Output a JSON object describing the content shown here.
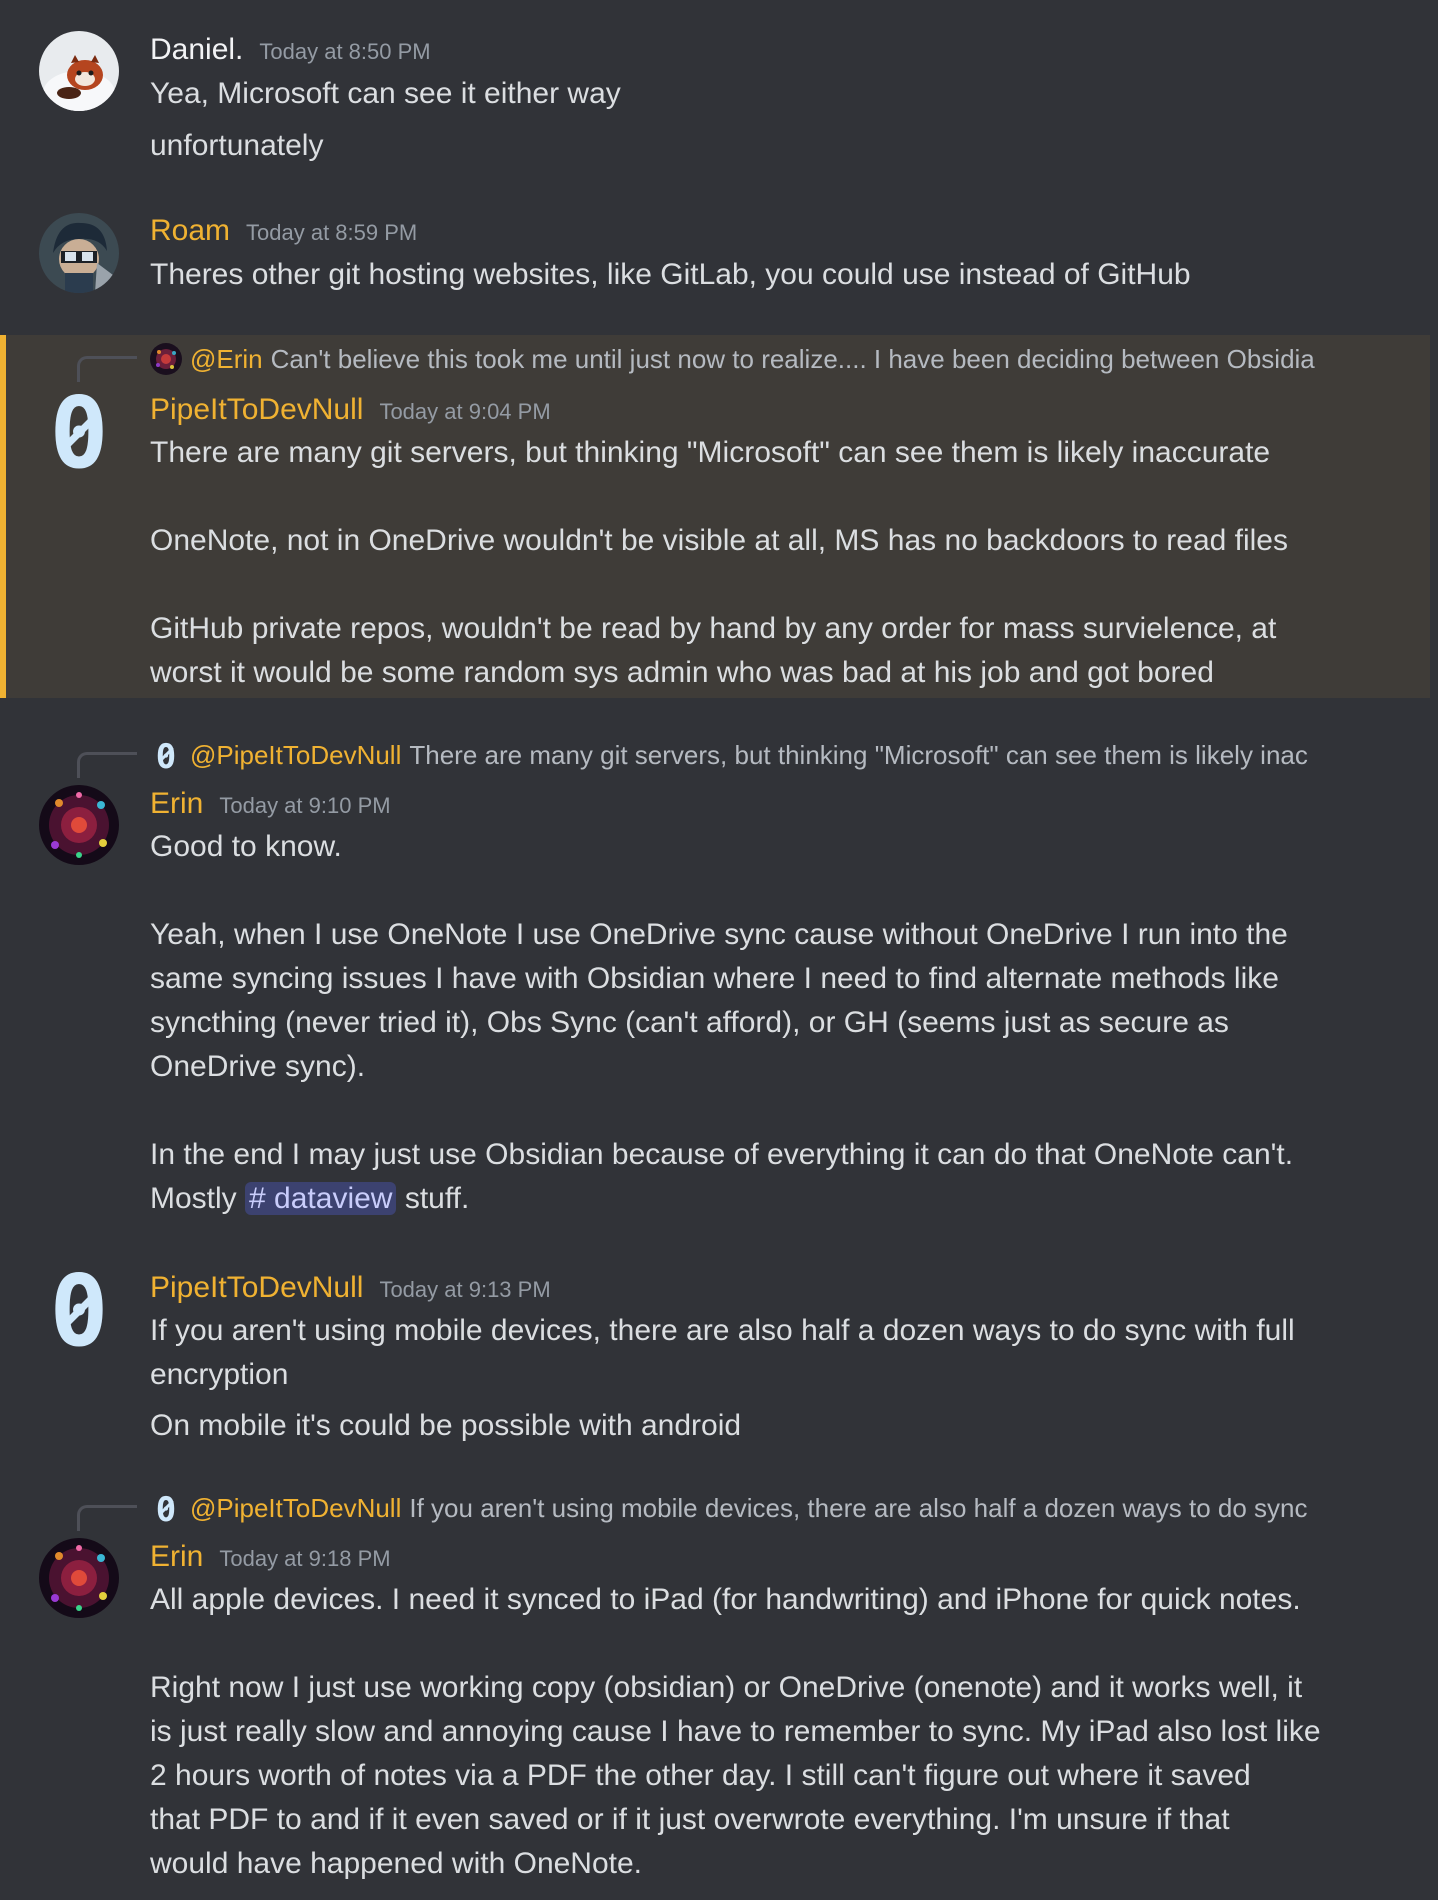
{
  "theme": {
    "background": "#313338",
    "text": "#dbdee1",
    "timestamp": "#949ba4",
    "highlight_bg": "#3f3c38",
    "highlight_bar": "#f0b232",
    "mention_bg": "#3c4270",
    "mention_text": "#c9cdfb"
  },
  "users": {
    "daniel": {
      "name": "Daniel.",
      "color": "#f2f3f5",
      "avatar_icon": "red-panda-avatar"
    },
    "roam": {
      "name": "Roam",
      "color": "#f0b232",
      "avatar_icon": "masked-character-avatar"
    },
    "pipe": {
      "name": "PipeItToDevNull",
      "color": "#f0b232",
      "avatar_icon": "zero-glyph-avatar"
    },
    "erin": {
      "name": "Erin",
      "color": "#f0b232",
      "avatar_icon": "fireworks-avatar"
    }
  },
  "messages": [
    {
      "author": "Daniel.",
      "timestamp": "Today at 8:50 PM",
      "lines": [
        "Yea, Microsoft can see it either way",
        "unfortunately"
      ]
    },
    {
      "author": "Roam",
      "timestamp": "Today at 8:59 PM",
      "lines": [
        "Theres other git hosting websites, like GitLab, you could use instead of GitHub"
      ]
    },
    {
      "author": "PipeItToDevNull",
      "timestamp": "Today at 9:04 PM",
      "reply_to": {
        "mention": "@Erin",
        "preview": "Can't believe this took me until just now to realize.... I have been deciding between Obsidia"
      },
      "lines": [
        "There are many git servers, but thinking \"Microsoft\" can see them is likely inaccurate",
        "OneNote, not in OneDrive wouldn't be visible at all, MS has no backdoors to read files",
        "GitHub private repos, wouldn't be read by hand by any order for mass survielence, at",
        "worst it would be some random sys admin who was bad at his job and got bored"
      ]
    },
    {
      "author": "Erin",
      "timestamp": "Today at 9:10 PM",
      "reply_to": {
        "mention": "@PipeItToDevNull",
        "preview": "There are many git servers, but thinking \"Microsoft\" can see them is likely inac"
      },
      "lines": [
        "Good to know.",
        "Yeah, when I use OneNote I use OneDrive sync cause without OneDrive I run into the",
        "same syncing issues I have with Obsidian where I need to find alternate methods like",
        "syncthing (never tried it), Obs Sync (can't afford), or GH (seems just as secure as",
        "OneDrive sync).",
        "In the end I may just use Obsidian because of everything it can do that OneNote can't.",
        "Mostly",
        "stuff."
      ],
      "channel_mention": "# dataview"
    },
    {
      "author": "PipeItToDevNull",
      "timestamp": "Today at 9:13 PM",
      "lines": [
        "If you aren't using mobile devices, there are also half a dozen ways to do sync with full",
        "encryption",
        "On mobile it's could be possible with android"
      ]
    },
    {
      "author": "Erin",
      "timestamp": "Today at 9:18 PM",
      "reply_to": {
        "mention": "@PipeItToDevNull",
        "preview": "If you aren't using mobile devices, there are also half a dozen ways to do sync "
      },
      "lines": [
        "All apple devices. I need it synced to iPad (for handwriting) and iPhone for quick notes.",
        "Right now I just use working copy (obsidian) or OneDrive (onenote) and it works well, it",
        "is just really slow and annoying cause I have to remember to sync. My iPad also lost like",
        "2 hours worth of notes via a PDF the other day. I still can't figure out where it saved",
        "that PDF to and if it even saved or if it just overwrote everything. I'm unsure if that",
        "would have happened with OneNote."
      ]
    }
  ]
}
